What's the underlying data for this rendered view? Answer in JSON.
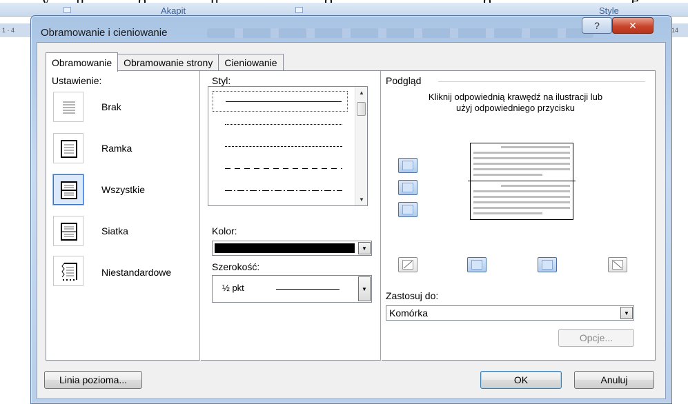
{
  "background": {
    "ribbon_group_paragraph": "Akapit",
    "ribbon_group_styles": "Style",
    "ruler_left_text": "1 · 4",
    "ruler_right_text": "·14"
  },
  "window": {
    "title": "Obramowanie i cieniowanie",
    "help_symbol": "?",
    "close_symbol": "✕"
  },
  "tabs": [
    {
      "label": "Obramowanie",
      "active": true
    },
    {
      "label": "Obramowanie strony",
      "active": false
    },
    {
      "label": "Cieniowanie",
      "active": false
    }
  ],
  "setting": {
    "heading": "Ustawienie:",
    "items": [
      {
        "label": "Brak",
        "selected": false
      },
      {
        "label": "Ramka",
        "selected": false
      },
      {
        "label": "Wszystkie",
        "selected": true
      },
      {
        "label": "Siatka",
        "selected": false
      },
      {
        "label": "Niestandardowe",
        "selected": false
      }
    ]
  },
  "style": {
    "heading": "Styl:",
    "items": [
      "solid",
      "dotted",
      "dashed-small",
      "dashed-large",
      "dash-dot"
    ],
    "selected_index": 0
  },
  "color": {
    "heading": "Kolor:",
    "value_hex": "#000000"
  },
  "width": {
    "heading": "Szerokość:",
    "value": "½ pkt"
  },
  "preview": {
    "heading": "Podgląd",
    "instruction": "Kliknij odpowiednią krawędź na ilustracji lub użyj odpowiedniego przycisku"
  },
  "apply_to": {
    "heading": "Zastosuj do:",
    "value": "Komórka"
  },
  "buttons": {
    "options": "Opcje...",
    "horizontal_line": "Linia pozioma...",
    "ok": "OK",
    "cancel": "Anuluj"
  },
  "colors": {
    "accent": "#3a76c4",
    "frame": "#a9c4e4",
    "close": "#c9462c"
  }
}
